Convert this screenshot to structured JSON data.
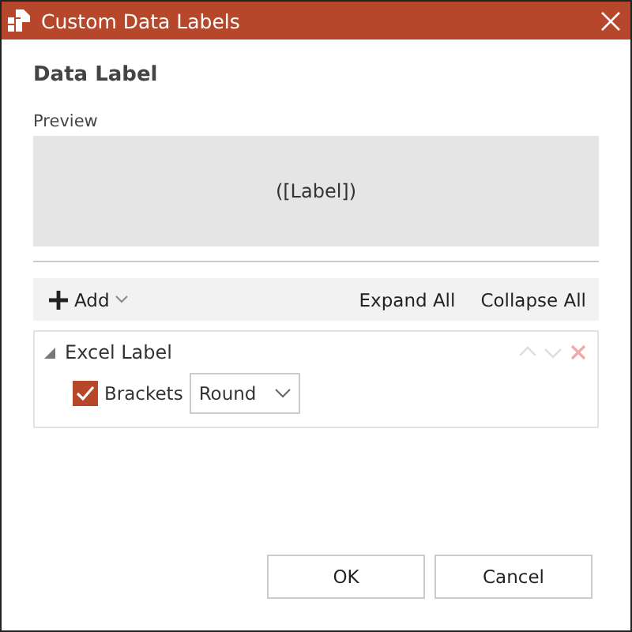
{
  "window": {
    "title": "Custom Data Labels"
  },
  "heading": "Data Label",
  "preview": {
    "label": "Preview",
    "text": "([Label])"
  },
  "toolbar": {
    "add": "Add",
    "expand": "Expand All",
    "collapse": "Collapse All"
  },
  "items": [
    {
      "title": "Excel Label",
      "expanded": true,
      "option": {
        "label": "Brackets",
        "checked": true,
        "value": "Round"
      }
    }
  ],
  "buttons": [
    "OK",
    "Cancel"
  ]
}
